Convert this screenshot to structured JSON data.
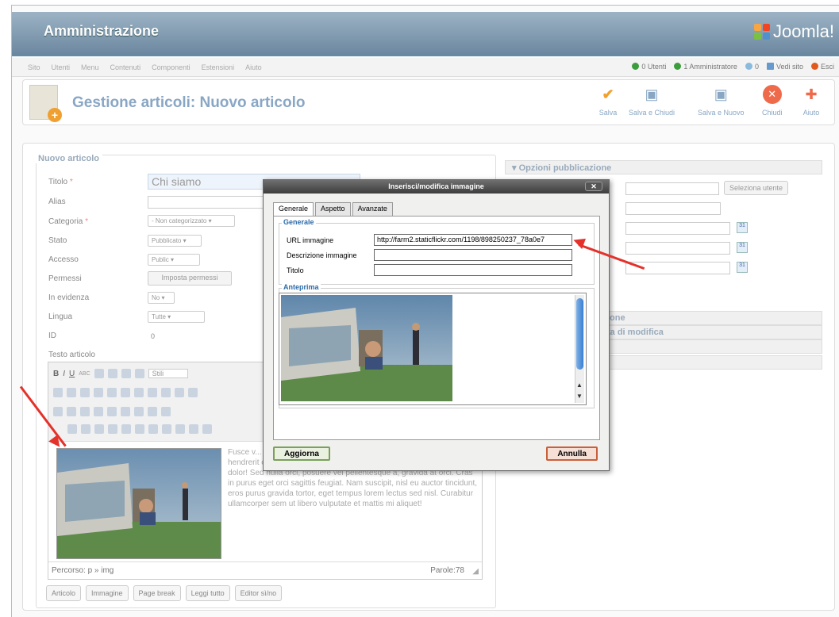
{
  "header": {
    "title": "Amministrazione",
    "logo_text": "Joomla!"
  },
  "menubar": {
    "items": [
      "Sito",
      "Utenti",
      "Menu",
      "Contenuti",
      "Componenti",
      "Estensioni",
      "Aiuto"
    ],
    "status": [
      {
        "label": "0 Utenti",
        "color": "#3b9e3b"
      },
      {
        "label": "1 Amministratore",
        "color": "#3b9e3b"
      },
      {
        "label": "0",
        "color": "#88bbdd"
      },
      {
        "label": "Vedi sito",
        "color": "#6699cc"
      },
      {
        "label": "Esci",
        "color": "#e05a1e"
      }
    ]
  },
  "toolbar": {
    "page_title": "Gestione articoli: Nuovo articolo",
    "buttons": [
      {
        "label": "Salva",
        "icon": "check-icon"
      },
      {
        "label": "Salva e Chiudi",
        "icon": "save-close-icon"
      },
      {
        "label": "Salva e Nuovo",
        "icon": "save-new-icon"
      },
      {
        "label": "Chiudi",
        "icon": "close-icon"
      },
      {
        "label": "Aiuto",
        "icon": "help-icon"
      }
    ]
  },
  "form": {
    "legend": "Nuovo articolo",
    "titolo_label": "Titolo",
    "titolo_value": "Chi siamo",
    "alias_label": "Alias",
    "categoria_label": "Categoria",
    "categoria_value": "- Non categorizzato",
    "stato_label": "Stato",
    "stato_value": "Pubblicato",
    "accesso_label": "Accesso",
    "accesso_value": "Public",
    "permessi_label": "Permessi",
    "permessi_button": "Imposta permessi",
    "evidenza_label": "In evidenza",
    "evidenza_value": "No",
    "lingua_label": "Lingua",
    "lingua_value": "Tutte",
    "id_label": "ID",
    "id_value": "0",
    "testo_label": "Testo articolo"
  },
  "editor": {
    "styles_label": "Stili",
    "body_text": "Fusce v... Integer ... congue dapibus, non velit pellentesque velit, nec hendrerit enim magna vitae mauris. Fusce vitae velit lorem, a dignissim dolor! Sed nulla orci, posuere vel pellentesque a; gravida at orci. Cras in purus eget orci sagittis feugiat. Nam suscipit, nisl eu auctor tincidunt, eros purus gravida tortor, eget tempus lorem lectus sed nisl. Curabitur ullamcorper sem ut libero vulputate et mattis mi aliquet!",
    "path": "Percorso: p » img",
    "wordcount": "Parole:78"
  },
  "editor_buttons": [
    "Articolo",
    "Immagine",
    "Page break",
    "Leggi tutto",
    "Editor sì/no"
  ],
  "right_panel": {
    "header1": "Opzioni pubblicazione",
    "select_user": "Seleziona utente",
    "header2_fragment": "ione",
    "header3_fragment": "ta di modifica"
  },
  "dialog": {
    "title": "Inserisci/modifica immagine",
    "tabs": [
      "Generale",
      "Aspetto",
      "Avanzate"
    ],
    "generale_legend": "Generale",
    "url_label": "URL immagine",
    "url_value": "http://farm2.staticflickr.com/1198/898250237_78a0e7",
    "desc_label": "Descrizione immagine",
    "titolo_label": "Titolo",
    "anteprima_legend": "Anteprima",
    "update_button": "Aggiorna",
    "cancel_button": "Annulla"
  }
}
